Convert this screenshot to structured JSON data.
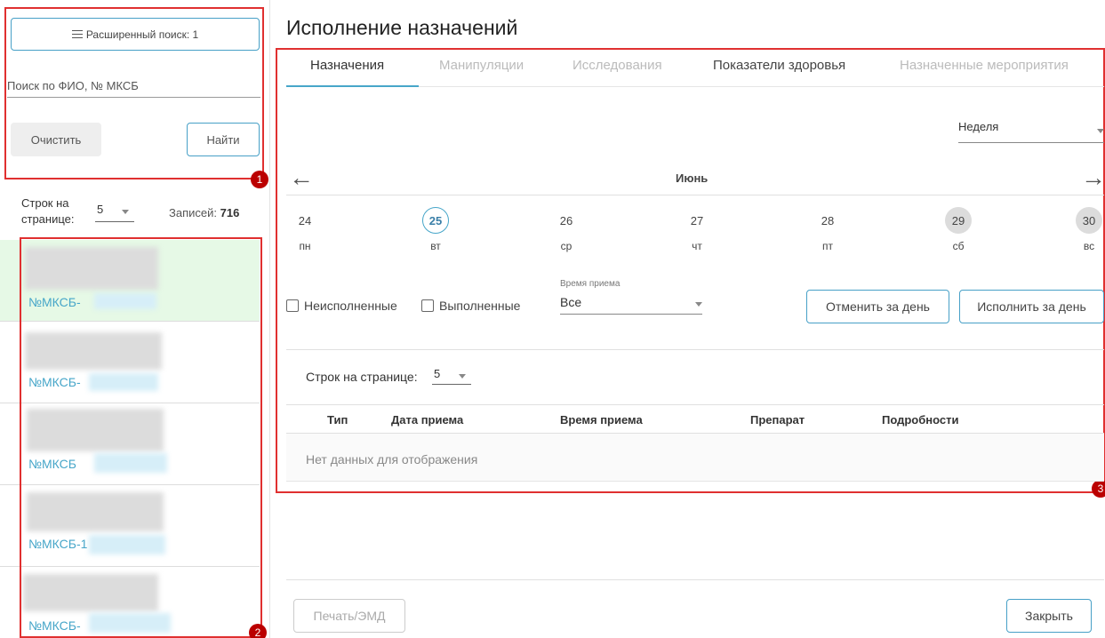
{
  "sidebar": {
    "advanced_search_label": "Расширенный поиск: 1",
    "search_placeholder": "Поиск по ФИО, № МКСБ",
    "clear_label": "Очистить",
    "find_label": "Найти",
    "rows_per_page_label": "Строк на странице:",
    "rows_per_page_value": "5",
    "records_label": "Записей:",
    "records_count": "716",
    "patients": [
      {
        "mkcb": "№МКСБ-"
      },
      {
        "mkcb": "№МКСБ-"
      },
      {
        "mkcb": "№МКСБ"
      },
      {
        "mkcb": "№МКСБ-1"
      },
      {
        "mkcb": "№МКСБ-"
      }
    ]
  },
  "markers": {
    "m1": "1",
    "m2": "2",
    "m3": "3"
  },
  "main": {
    "title": "Исполнение назначений",
    "tabs": [
      {
        "label": "Назначения"
      },
      {
        "label": "Манипуляции"
      },
      {
        "label": "Исследования"
      },
      {
        "label": "Показатели здоровья"
      },
      {
        "label": "Назначенные мероприятия"
      }
    ],
    "period_value": "Неделя",
    "month": "Июнь",
    "days": [
      {
        "num": "24",
        "name": "пн"
      },
      {
        "num": "25",
        "name": "вт"
      },
      {
        "num": "26",
        "name": "ср"
      },
      {
        "num": "27",
        "name": "чт"
      },
      {
        "num": "28",
        "name": "пт"
      },
      {
        "num": "29",
        "name": "сб"
      },
      {
        "num": "30",
        "name": "вс"
      }
    ],
    "filters": {
      "unexecuted": "Неисполненные",
      "executed": "Выполненные",
      "time_label": "Время приема",
      "time_value": "Все"
    },
    "cancel_day_label": "Отменить за день",
    "execute_day_label": "Исполнить за день",
    "table": {
      "rows_per_page_label": "Строк на странице:",
      "rows_per_page_value": "5",
      "columns": [
        "Тип",
        "Дата приема",
        "Время приема",
        "Препарат",
        "Подробности"
      ],
      "empty_text": "Нет данных для отображения"
    },
    "print_label": "Печать/ЭМД",
    "close_label": "Закрыть"
  },
  "colors": {
    "accent": "#47a6c9",
    "annotation": "#e03030",
    "selected_row": "#e6f9e6"
  }
}
